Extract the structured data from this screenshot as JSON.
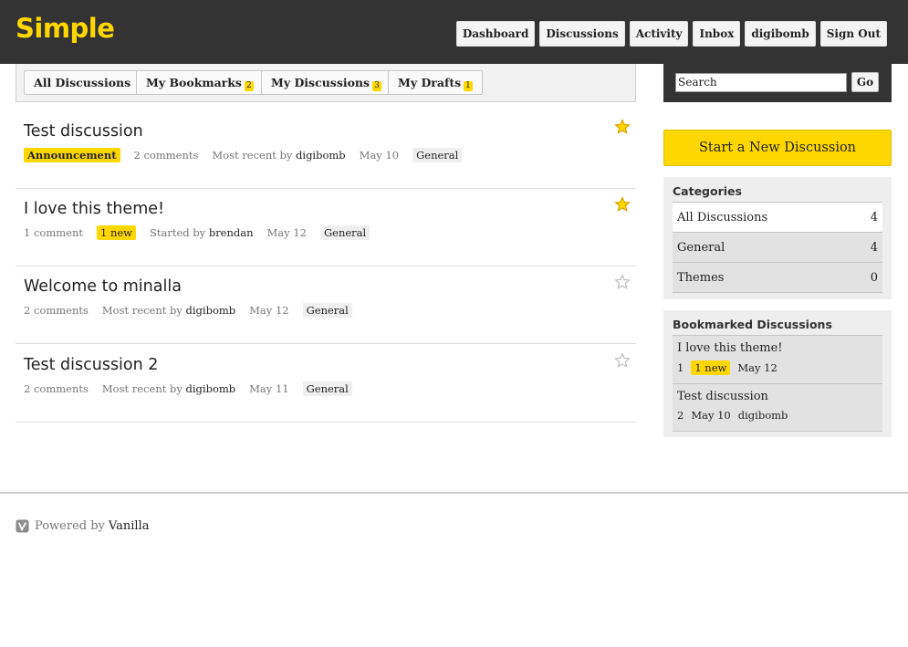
{
  "app": {
    "logo": "Simple"
  },
  "topnav": [
    "Dashboard",
    "Discussions",
    "Activity",
    "Inbox",
    "digibomb",
    "Sign Out"
  ],
  "tabs": [
    {
      "label": "All Discussions",
      "count": ""
    },
    {
      "label": "My Bookmarks",
      "count": "2"
    },
    {
      "label": "My Discussions",
      "count": "3"
    },
    {
      "label": "My Drafts",
      "count": "1"
    }
  ],
  "discussions": [
    {
      "title": "Test discussion",
      "bookmarked": true,
      "announcement": "Announcement",
      "comments": "2 comments",
      "new": "",
      "by_label": "Most recent by",
      "user": "digibomb",
      "date": "May 10",
      "category": "General"
    },
    {
      "title": "I love this theme!",
      "bookmarked": true,
      "announcement": "",
      "comments": "1 comment",
      "new": "1 new",
      "by_label": "Started by",
      "user": "brendan",
      "date": "May 12",
      "category": "General"
    },
    {
      "title": "Welcome to minalla",
      "bookmarked": false,
      "announcement": "",
      "comments": "2 comments",
      "new": "",
      "by_label": "Most recent by",
      "user": "digibomb",
      "date": "May 12",
      "category": "General"
    },
    {
      "title": "Test discussion 2",
      "bookmarked": false,
      "announcement": "",
      "comments": "2 comments",
      "new": "",
      "by_label": "Most recent by",
      "user": "digibomb",
      "date": "May 11",
      "category": "General"
    }
  ],
  "search": {
    "value": "Search",
    "button": "Go"
  },
  "new_discussion": "Start a New Discussion",
  "categories": {
    "title": "Categories",
    "items": [
      {
        "name": "All Discussions",
        "count": "4"
      },
      {
        "name": "General",
        "count": "4"
      },
      {
        "name": "Themes",
        "count": "0"
      }
    ]
  },
  "bookmarked": {
    "title": "Bookmarked Discussions",
    "items": [
      {
        "title": "I love this theme!",
        "count": "1",
        "new": "1 new",
        "date": "May 12",
        "user": ""
      },
      {
        "title": "Test discussion",
        "count": "2",
        "new": "",
        "date": "May 10",
        "user": "digibomb"
      }
    ]
  },
  "footer": {
    "powered_by": "Powered by",
    "link": "Vanilla"
  },
  "colors": {
    "header": "#333333",
    "accent": "#ffd700",
    "star_on": "#f0b400",
    "star_off": "#bbbbbb"
  }
}
